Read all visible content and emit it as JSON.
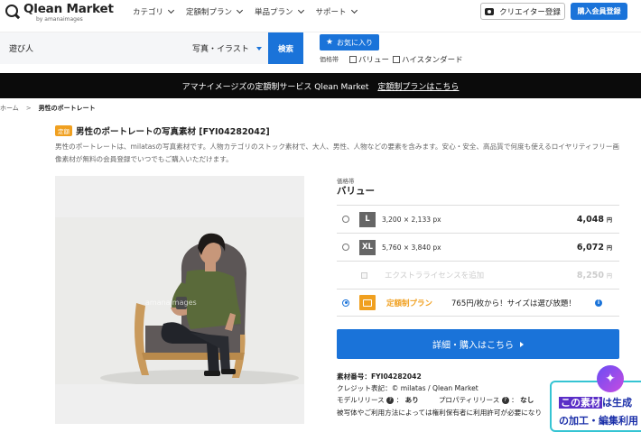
{
  "header": {
    "logo_title": "Qlean Market",
    "logo_sub": "by amanaimages",
    "nav": [
      "カテゴリ",
      "定額制プラン",
      "単品プラン",
      "サポート"
    ],
    "creator_button": "クリエイター登録",
    "register_button": "購入会員登録"
  },
  "search": {
    "query": "遊び人",
    "type": "写真・イラスト",
    "search_button": "検索",
    "favorite_button": "お気に入り",
    "price_label": "価格帯",
    "price_options": [
      "バリュー",
      "ハイスタンダード"
    ]
  },
  "banner": {
    "text": "アマナイメージズの定額制サービス Qlean Market",
    "link": "定額制プランはこちら"
  },
  "breadcrumb": {
    "home": "ホーム",
    "sep": ">",
    "current": "男性のポートレート"
  },
  "product": {
    "badge": "定額",
    "title": "男性のポートレートの写真素材 [FYI04282042]",
    "description": "男性のポートレートは、milatasの写真素材です。人物カテゴリのストック素材で、大人、男性、人物などの要素を含みます。安心・安全、高品質で何度も使えるロイヤリティフリー画像素材が無料の会員登録でいつでもご購入いただけます。",
    "price_tier_small": "価格帯",
    "price_tier": "バリュー",
    "sizes": [
      {
        "label": "L",
        "dimensions": "3,200 × 2,133 px",
        "price": "4,048",
        "unit": "円"
      },
      {
        "label": "XL",
        "dimensions": "5,760 × 3,840 px",
        "price": "6,072",
        "unit": "円"
      }
    ],
    "extra_license": {
      "label": "エクストラライセンスを追加",
      "price": "8,250",
      "unit": "円"
    },
    "plan": {
      "name": "定額制プラン",
      "text": "765円/枚から！サイズは選び放題！"
    },
    "buy_button": "詳細・購入はこちら",
    "meta": {
      "id_label": "素材番号：",
      "id": "FYI04282042",
      "credit": "クレジット表記：© milatas / Qlean Market",
      "model_release_label": "モデルリリース",
      "model_release": "あり",
      "property_release_label": "プロパティリリース",
      "property_release": "なし",
      "note": "被写体やご利用方法によっては権利保有者に利用許可が必要になり"
    },
    "watermark": "amanaimages"
  },
  "ai_popup": {
    "highlight": "この素材",
    "line1_rest": "は生成",
    "line2": "の加工・編集利用"
  },
  "colors": {
    "accent": "#1a73d9",
    "plan_orange": "#f0a020",
    "banner_bg": "#0b0b0b"
  }
}
